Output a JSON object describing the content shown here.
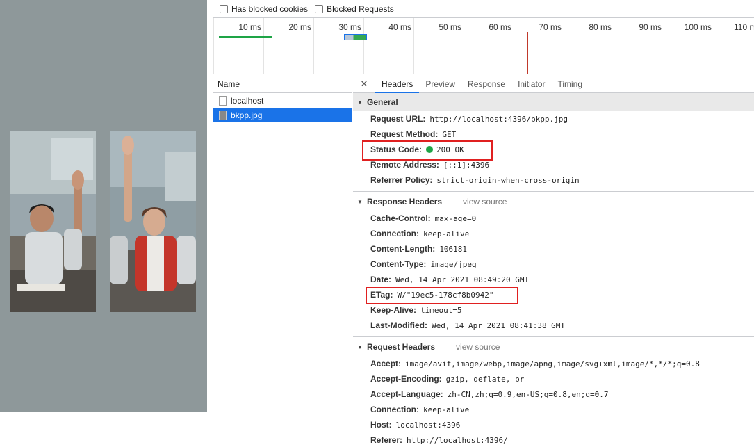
{
  "filters": {
    "has_blocked_cookies": "Has blocked cookies",
    "blocked_requests": "Blocked Requests"
  },
  "timeline": {
    "ticks": [
      "10 ms",
      "20 ms",
      "30 ms",
      "40 ms",
      "50 ms",
      "60 ms",
      "70 ms",
      "80 ms",
      "90 ms",
      "100 ms",
      "110 m"
    ]
  },
  "requests": {
    "header": "Name",
    "items": [
      {
        "name": "localhost",
        "icon": "document-icon",
        "selected": false
      },
      {
        "name": "bkpp.jpg",
        "icon": "image-file-icon",
        "selected": true
      }
    ]
  },
  "tabs": [
    "Headers",
    "Preview",
    "Response",
    "Initiator",
    "Timing"
  ],
  "general": {
    "title": "General",
    "rows": [
      {
        "key": "Request URL:",
        "value": "http://localhost:4396/bkpp.jpg"
      },
      {
        "key": "Request Method:",
        "value": "GET"
      },
      {
        "key": "Status Code:",
        "value": "200 OK"
      },
      {
        "key": "Remote Address:",
        "value": "[::1]:4396"
      },
      {
        "key": "Referrer Policy:",
        "value": "strict-origin-when-cross-origin"
      }
    ]
  },
  "response_headers": {
    "title": "Response Headers",
    "view_source": "view source",
    "rows": [
      {
        "key": "Cache-Control:",
        "value": "max-age=0"
      },
      {
        "key": "Connection:",
        "value": "keep-alive"
      },
      {
        "key": "Content-Length:",
        "value": "106181"
      },
      {
        "key": "Content-Type:",
        "value": "image/jpeg"
      },
      {
        "key": "Date:",
        "value": "Wed, 14 Apr 2021 08:49:20 GMT"
      },
      {
        "key": "ETag:",
        "value": "W/\"19ec5-178cf8b0942\""
      },
      {
        "key": "Keep-Alive:",
        "value": "timeout=5"
      },
      {
        "key": "Last-Modified:",
        "value": "Wed, 14 Apr 2021 08:41:38 GMT"
      }
    ]
  },
  "request_headers": {
    "title": "Request Headers",
    "view_source": "view source",
    "rows": [
      {
        "key": "Accept:",
        "value": "image/avif,image/webp,image/apng,image/svg+xml,image/*,*/*;q=0.8"
      },
      {
        "key": "Accept-Encoding:",
        "value": "gzip, deflate, br"
      },
      {
        "key": "Accept-Language:",
        "value": "zh-CN,zh;q=0.9,en-US;q=0.8,en;q=0.7"
      },
      {
        "key": "Connection:",
        "value": "keep-alive"
      },
      {
        "key": "Host:",
        "value": "localhost:4396"
      },
      {
        "key": "Referer:",
        "value": "http://localhost:4396/"
      }
    ]
  },
  "colors": {
    "accent": "#1a73e8",
    "status_ok": "#1ea446",
    "highlight": "#e02020",
    "preview_bg": "#8e989a"
  }
}
